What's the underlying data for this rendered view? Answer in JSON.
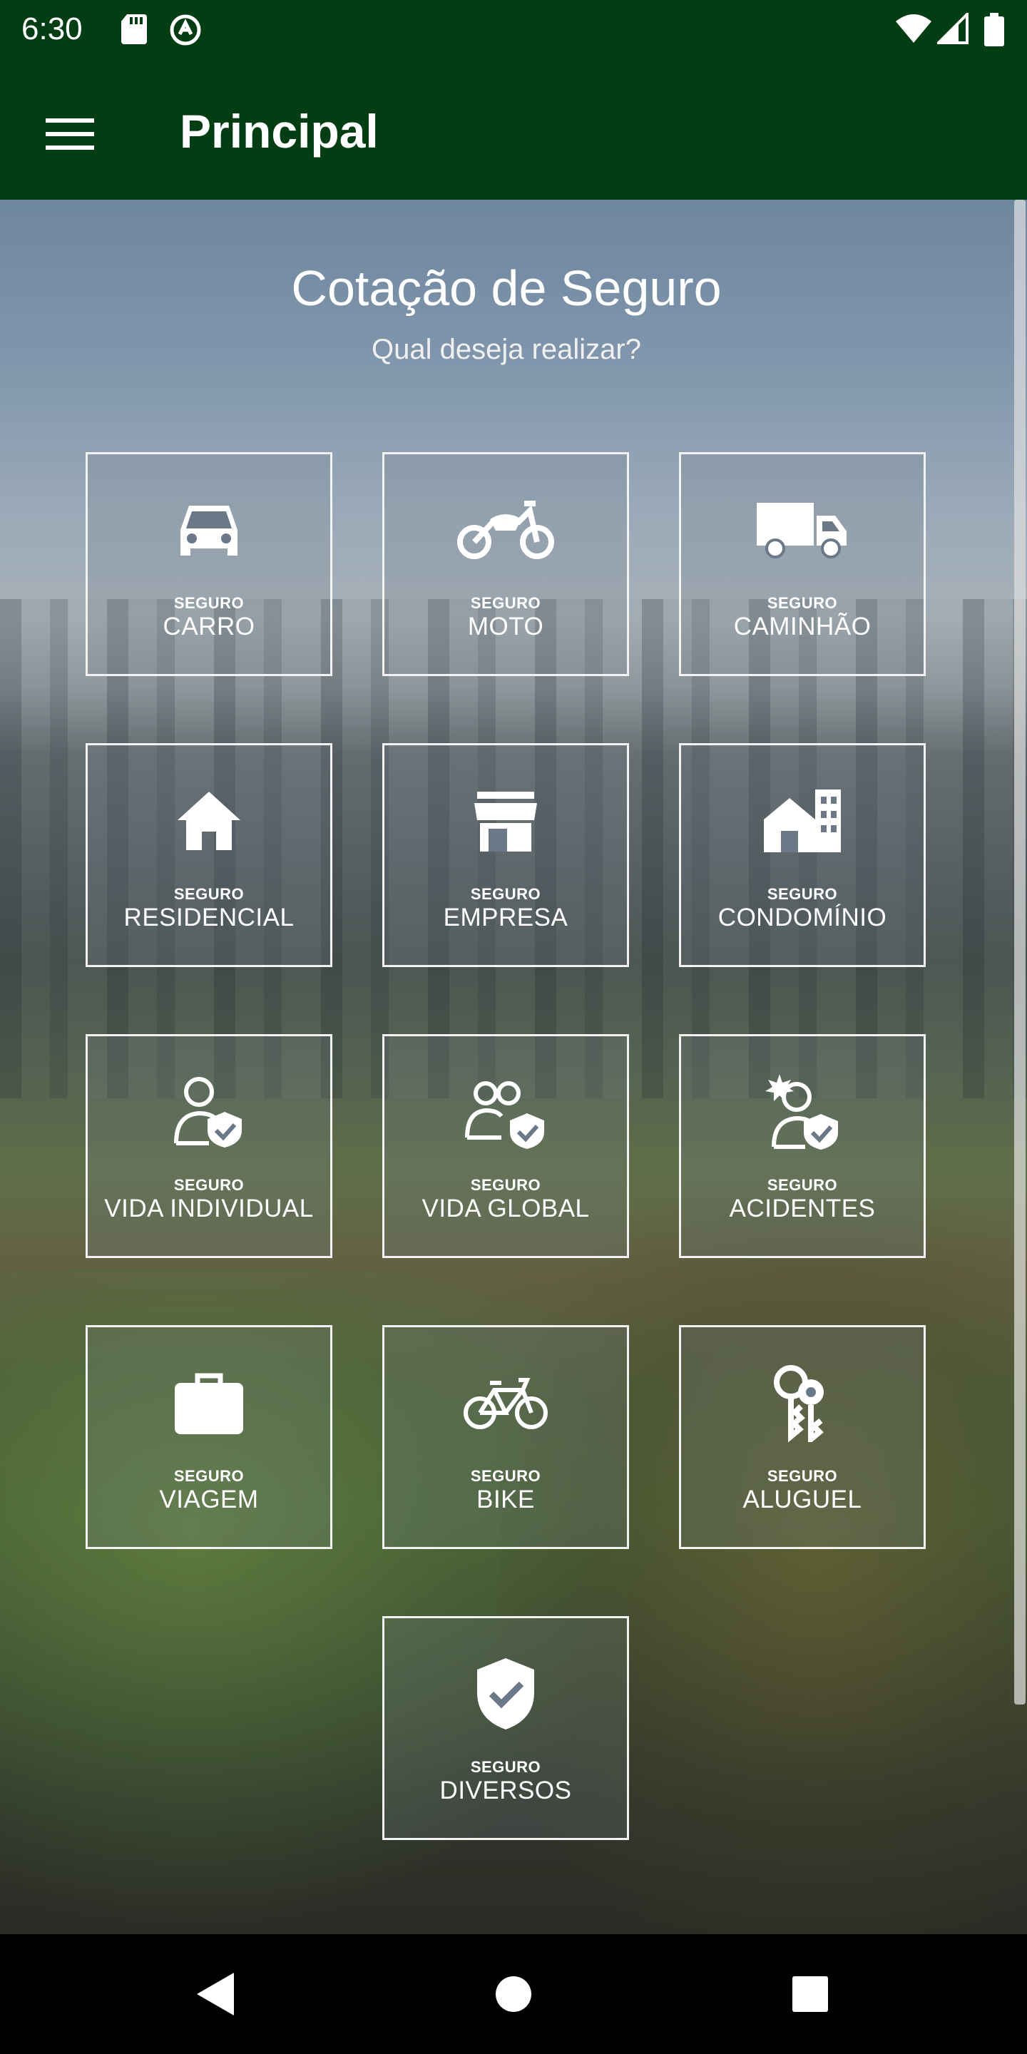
{
  "status_bar": {
    "time": "6:30"
  },
  "app_bar": {
    "title": "Principal"
  },
  "main": {
    "heading": "Cotação de Seguro",
    "subheading": "Qual deseja realizar?",
    "tiles": [
      {
        "prefix": "SEGURO",
        "label": "CARRO",
        "icon": "car-icon"
      },
      {
        "prefix": "SEGURO",
        "label": "MOTO",
        "icon": "motorcycle-icon"
      },
      {
        "prefix": "SEGURO",
        "label": "CAMINHÃO",
        "icon": "truck-icon"
      },
      {
        "prefix": "SEGURO",
        "label": "RESIDENCIAL",
        "icon": "house-icon"
      },
      {
        "prefix": "SEGURO",
        "label": "EMPRESA",
        "icon": "store-icon"
      },
      {
        "prefix": "SEGURO",
        "label": "CONDOMÍNIO",
        "icon": "building-icon"
      },
      {
        "prefix": "SEGURO",
        "label": "VIDA INDIVIDUAL",
        "icon": "person-shield-icon"
      },
      {
        "prefix": "SEGURO",
        "label": "VIDA GLOBAL",
        "icon": "group-shield-icon"
      },
      {
        "prefix": "SEGURO",
        "label": "ACIDENTES",
        "icon": "accident-person-icon"
      },
      {
        "prefix": "SEGURO",
        "label": "VIAGEM",
        "icon": "briefcase-icon"
      },
      {
        "prefix": "SEGURO",
        "label": "BIKE",
        "icon": "bicycle-icon"
      },
      {
        "prefix": "SEGURO",
        "label": "ALUGUEL",
        "icon": "keys-icon"
      },
      {
        "prefix": "SEGURO",
        "label": "DIVERSOS",
        "icon": "shield-check-icon"
      }
    ]
  },
  "colors": {
    "app_bar": "#023d13",
    "tile_border": "#f2f2f2",
    "text": "#ffffff"
  }
}
